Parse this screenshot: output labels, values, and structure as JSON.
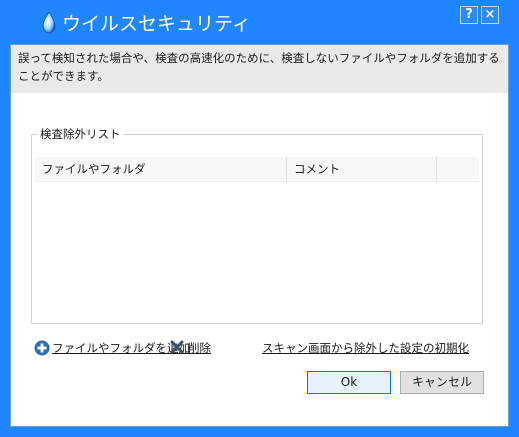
{
  "window": {
    "title": "ウイルスセキュリティ",
    "help_label": "?",
    "close_label": "×",
    "accent": "#1f86ff"
  },
  "description": "誤って検知された場合や、検査の高速化のために、検査しないファイルやフォルダを追加することができます。",
  "exclusion_list": {
    "label": "検査除外リスト",
    "columns": [
      "ファイルやフォルダ",
      "コメント",
      ""
    ],
    "rows": []
  },
  "actions": {
    "add_label": "ファイルやフォルダを追加",
    "delete_label": "削除",
    "reset_label": "スキャン画面から除外した設定の初期化"
  },
  "buttons": {
    "ok_label": "Ok",
    "cancel_label": "キャンセル"
  },
  "icons": {
    "app": "water-drop-icon",
    "add": "plus-circle-icon",
    "delete": "x-icon"
  }
}
